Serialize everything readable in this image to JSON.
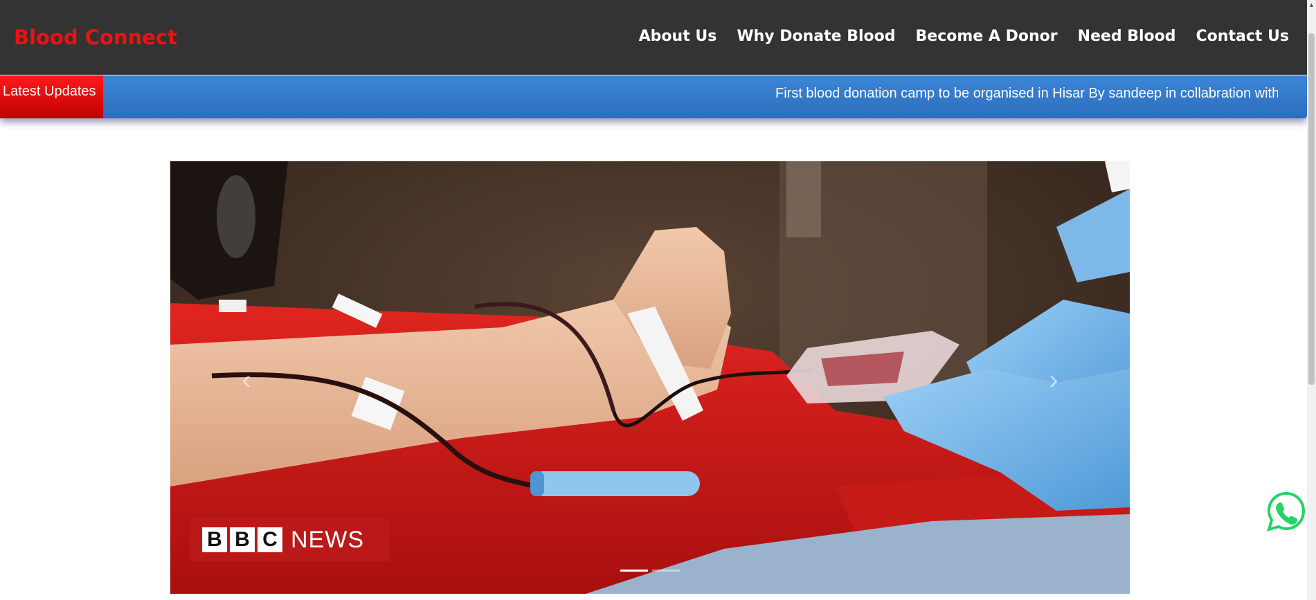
{
  "navbar": {
    "brand": "Blood Connect",
    "links": [
      "About Us",
      "Why Donate Blood",
      "Become A Donor",
      "Need Blood",
      "Contact Us"
    ]
  },
  "ticker": {
    "label": "Latest Updates",
    "text": "First blood donation camp to be organised in Hisar By sandeep in collabration with"
  },
  "carousel": {
    "slide": {
      "image": "blood-donation-arm-with-gloved-hands-and-blood-bag",
      "watermark_letters": [
        "B",
        "B",
        "C"
      ],
      "watermark_word": "NEWS"
    },
    "prev_icon": "chevron-left-icon",
    "next_icon": "chevron-right-icon",
    "indicator_count": 2,
    "active_indicator": 0
  },
  "whatsapp": {
    "icon": "whatsapp-icon",
    "color": "#25d366"
  },
  "colors": {
    "brand": "#ee1111",
    "navbar_bg": "#333333",
    "ticker_bg": "#3c85d6",
    "ticker_label_bg": "#dd0000"
  }
}
